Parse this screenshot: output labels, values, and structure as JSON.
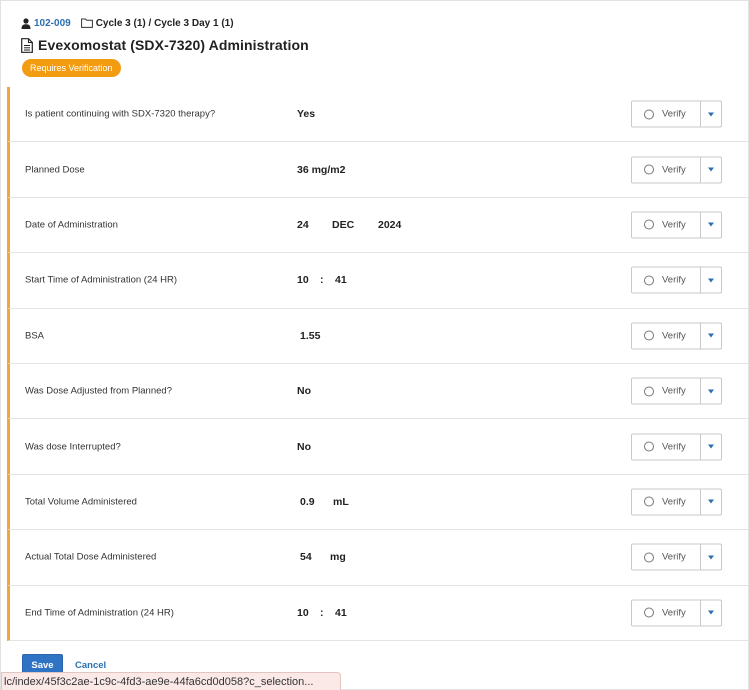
{
  "header": {
    "subject_id": "102-009",
    "visit_path": "Cycle 3 (1) / Cycle 3 Day 1 (1)",
    "title": "Evexomostat (SDX-7320) Administration",
    "badge": "Requires Verification"
  },
  "icons": {
    "subject": "user-icon",
    "folder": "folder-icon",
    "document": "document-icon",
    "verify": "radio-circle-icon",
    "caret": "caret-down-icon"
  },
  "colors": {
    "accent": "#2a6fb0",
    "badge": "#f39c12",
    "row_marker": "#f0a63c",
    "save_button": "#2f73c4"
  },
  "rows": [
    {
      "label": "Is patient continuing with SDX-7320 therapy?",
      "v1": "Yes",
      "v2": "",
      "v3": "",
      "verify": "Verify"
    },
    {
      "label": "Planned Dose",
      "v1": "36 mg/m2",
      "v2": "",
      "v3": "",
      "verify": "Verify"
    },
    {
      "label": "Date of Administration",
      "v1": "24",
      "v2": "DEC",
      "v3": "2024",
      "verify": "Verify"
    },
    {
      "label": "Start Time of Administration (24 HR)",
      "v1": "10",
      "v2": ":",
      "v3": "41",
      "verify": "Verify"
    },
    {
      "label": "BSA",
      "v1": "1.55",
      "v2": "",
      "v3": "",
      "verify": "Verify"
    },
    {
      "label": "Was Dose Adjusted from Planned?",
      "v1": "No",
      "v2": "",
      "v3": "",
      "verify": "Verify"
    },
    {
      "label": "Was dose Interrupted?",
      "v1": "No",
      "v2": "",
      "v3": "",
      "verify": "Verify"
    },
    {
      "label": "Total Volume Administered",
      "v1": "0.9",
      "v2": "mL",
      "v3": "",
      "verify": "Verify"
    },
    {
      "label": "Actual Total Dose Administered",
      "v1": "54",
      "v2": "mg",
      "v3": "",
      "verify": "Verify"
    },
    {
      "label": "End Time of Administration (24 HR)",
      "v1": "10",
      "v2": ":",
      "v3": "41",
      "verify": "Verify"
    }
  ],
  "footer": {
    "save_label": "Save",
    "cancel_label": "Cancel"
  },
  "statusbar": {
    "url": "lc/index/45f3c2ae-1c9c-4fd3-ae9e-44fa6cd0d058?c_selection..."
  }
}
